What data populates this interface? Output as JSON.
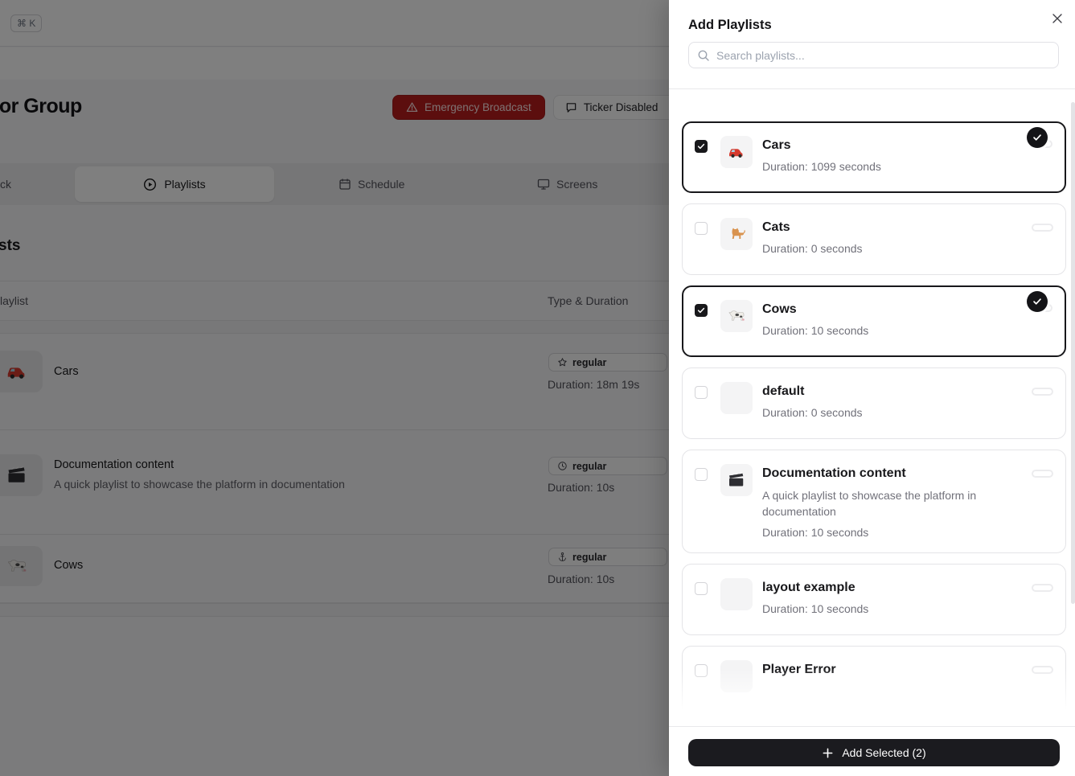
{
  "colors": {
    "emergency_red": "#b91c1c",
    "accent_dark": "#18181b"
  },
  "topbar": {
    "shortcut": "⌘ K"
  },
  "header": {
    "title": "tor Group",
    "emergency_label": "Emergency Broadcast",
    "ticker_label": "Ticker Disabled"
  },
  "tabs": {
    "tab_cut": "ck",
    "playlists": "Playlists",
    "schedule": "Schedule",
    "screens": "Screens"
  },
  "playlists_section": {
    "title": "sts",
    "columns": {
      "playlist": "laylist",
      "type_duration": "Type & Duration"
    },
    "rows": [
      {
        "title": "Cars",
        "icon": "car",
        "type": "regular",
        "type_icon": "star",
        "duration": "Duration: 18m 19s"
      },
      {
        "title": "Documentation content",
        "icon": "clapper",
        "description": "A quick playlist to showcase the platform in documentation",
        "type": "regular",
        "type_icon": "clock",
        "duration": "Duration: 10s"
      },
      {
        "title": "Cows",
        "icon": "cow",
        "type": "regular",
        "type_icon": "anchor",
        "duration": "Duration: 10s"
      }
    ]
  },
  "panel": {
    "title": "Add Playlists",
    "search_placeholder": "Search playlists...",
    "items": [
      {
        "title": "Cars",
        "icon": "car",
        "duration": "Duration: 1099 seconds",
        "checked": true
      },
      {
        "title": "Cats",
        "icon": "cat",
        "duration": "Duration: 0 seconds",
        "checked": false
      },
      {
        "title": "Cows",
        "icon": "cow",
        "duration": "Duration: 10 seconds",
        "checked": true
      },
      {
        "title": "default",
        "icon": "none",
        "duration": "Duration: 0 seconds",
        "checked": false
      },
      {
        "title": "Documentation content",
        "icon": "clapper",
        "description": "A quick playlist to showcase the platform in documentation",
        "duration": "Duration: 10 seconds",
        "checked": false
      },
      {
        "title": "layout example",
        "icon": "none",
        "duration": "Duration: 10 seconds",
        "checked": false
      },
      {
        "title": "Player Error",
        "icon": "none",
        "checked": false
      }
    ],
    "add_button": "Add Selected (2)"
  }
}
